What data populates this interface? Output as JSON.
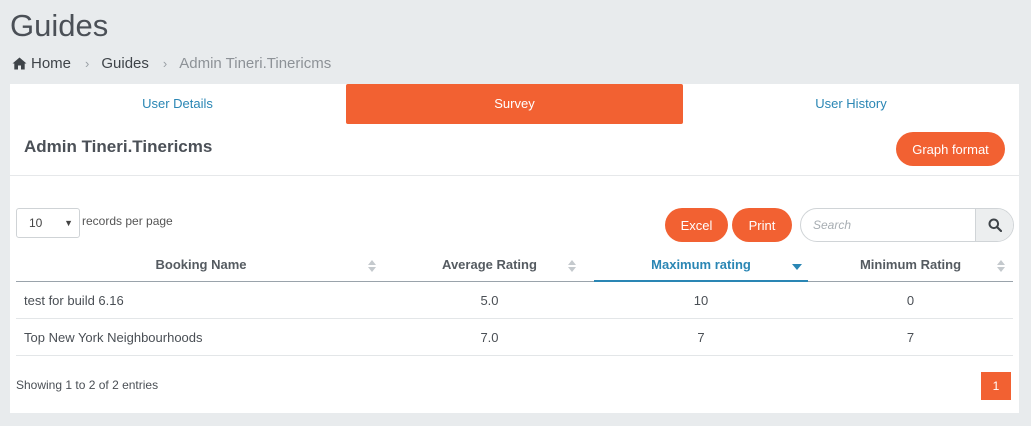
{
  "page": {
    "title": "Guides"
  },
  "breadcrumb": {
    "home": "Home",
    "guides": "Guides",
    "current": "Admin Tineri.Tinericms"
  },
  "tabs": [
    "User Details",
    "Survey",
    "User History"
  ],
  "profile": {
    "name": "Admin Tineri.Tinericms",
    "graph_button": "Graph format"
  },
  "table_controls": {
    "length_value": "10",
    "length_label": "records per page",
    "excel": "Excel",
    "print": "Print",
    "search_placeholder": "Search"
  },
  "table": {
    "headers": [
      "Booking Name",
      "Average Rating",
      "Maximum rating",
      "Minimum Rating"
    ],
    "sorted_column": "Maximum rating",
    "rows": [
      [
        "test for build 6.16",
        "5.0",
        "10",
        "0"
      ],
      [
        "Top New York Neighbourhoods",
        "7.0",
        "7",
        "7"
      ]
    ]
  },
  "footer": {
    "info": "Showing 1 to 2 of 2 entries",
    "current_page": "1"
  },
  "colors": {
    "accent": "#f26132",
    "link": "#2a86b4",
    "background": "#e8ebed"
  }
}
